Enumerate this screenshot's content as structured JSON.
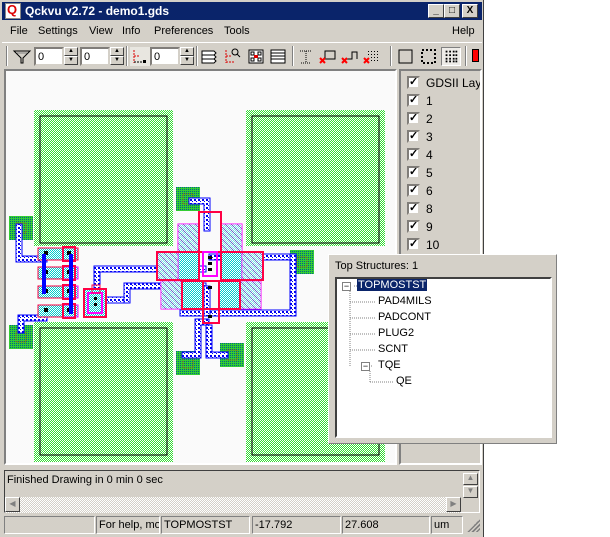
{
  "window": {
    "title": "Qckvu v2.72 - demo1.gds",
    "app_icon_letter": "Q",
    "controls": {
      "minimize": "_",
      "maximize": "□",
      "close": "X"
    }
  },
  "menu": {
    "items": [
      "File",
      "Settings",
      "View",
      "Info",
      "Preferences",
      "Tools"
    ],
    "help": "Help"
  },
  "toolbar": {
    "spin1_value": "0",
    "spin2_value": "0",
    "spin3_value": "0",
    "icons": [
      "filter-icon",
      "hierarchy-icon",
      "layers-stack-icon",
      "hierarchy-search-icon",
      "select-cells-icon",
      "list-lines-icon",
      "ruler-icon",
      "delete-box-icon",
      "delete-path-icon",
      "delete-grid-icon",
      "outline-box-icon",
      "dotted-box-icon",
      "grid-fill-icon",
      "color-red-icon"
    ],
    "accent_color": "#ff0000"
  },
  "layers": {
    "header": "GDSII Layers",
    "items": [
      "1",
      "2",
      "3",
      "4",
      "5",
      "6",
      "8",
      "9",
      "10"
    ],
    "checked": true
  },
  "structures": {
    "header": "Top Structures: 1",
    "tree": [
      {
        "label": "TOPMOSTST",
        "level": 0,
        "expanded": true,
        "selected": true
      },
      {
        "label": "PAD4MILS",
        "level": 1
      },
      {
        "label": "PADCONT",
        "level": 1
      },
      {
        "label": "PLUG2",
        "level": 1
      },
      {
        "label": "SCNT",
        "level": 1
      },
      {
        "label": "TQE",
        "level": 1,
        "expanded": true
      },
      {
        "label": "QE",
        "level": 2
      }
    ]
  },
  "messages": {
    "text": "Finished Drawing in 0 min 0 sec"
  },
  "status": {
    "pane1": "",
    "help": "For help, mo",
    "structure": "TOPMOSTST",
    "x": "-17.792",
    "y": "27.608",
    "units": "um"
  },
  "layout_colors": {
    "pad_green": "#33dd33",
    "poly_magenta": "#ff00ff",
    "diff_red": "#ff0044",
    "metal_blue": "#0000ff",
    "cyan": "#00dddd"
  }
}
